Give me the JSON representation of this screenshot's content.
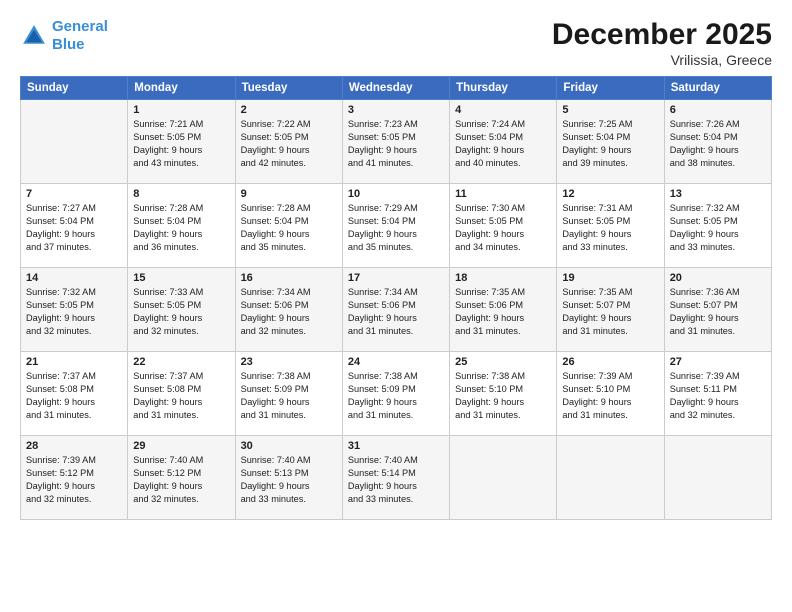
{
  "logo": {
    "line1": "General",
    "line2": "Blue"
  },
  "title": "December 2025",
  "location": "Vrilissia, Greece",
  "days_of_week": [
    "Sunday",
    "Monday",
    "Tuesday",
    "Wednesday",
    "Thursday",
    "Friday",
    "Saturday"
  ],
  "weeks": [
    [
      {
        "day": "",
        "info": ""
      },
      {
        "day": "1",
        "info": "Sunrise: 7:21 AM\nSunset: 5:05 PM\nDaylight: 9 hours\nand 43 minutes."
      },
      {
        "day": "2",
        "info": "Sunrise: 7:22 AM\nSunset: 5:05 PM\nDaylight: 9 hours\nand 42 minutes."
      },
      {
        "day": "3",
        "info": "Sunrise: 7:23 AM\nSunset: 5:05 PM\nDaylight: 9 hours\nand 41 minutes."
      },
      {
        "day": "4",
        "info": "Sunrise: 7:24 AM\nSunset: 5:04 PM\nDaylight: 9 hours\nand 40 minutes."
      },
      {
        "day": "5",
        "info": "Sunrise: 7:25 AM\nSunset: 5:04 PM\nDaylight: 9 hours\nand 39 minutes."
      },
      {
        "day": "6",
        "info": "Sunrise: 7:26 AM\nSunset: 5:04 PM\nDaylight: 9 hours\nand 38 minutes."
      }
    ],
    [
      {
        "day": "7",
        "info": "Sunrise: 7:27 AM\nSunset: 5:04 PM\nDaylight: 9 hours\nand 37 minutes."
      },
      {
        "day": "8",
        "info": "Sunrise: 7:28 AM\nSunset: 5:04 PM\nDaylight: 9 hours\nand 36 minutes."
      },
      {
        "day": "9",
        "info": "Sunrise: 7:28 AM\nSunset: 5:04 PM\nDaylight: 9 hours\nand 35 minutes."
      },
      {
        "day": "10",
        "info": "Sunrise: 7:29 AM\nSunset: 5:04 PM\nDaylight: 9 hours\nand 35 minutes."
      },
      {
        "day": "11",
        "info": "Sunrise: 7:30 AM\nSunset: 5:05 PM\nDaylight: 9 hours\nand 34 minutes."
      },
      {
        "day": "12",
        "info": "Sunrise: 7:31 AM\nSunset: 5:05 PM\nDaylight: 9 hours\nand 33 minutes."
      },
      {
        "day": "13",
        "info": "Sunrise: 7:32 AM\nSunset: 5:05 PM\nDaylight: 9 hours\nand 33 minutes."
      }
    ],
    [
      {
        "day": "14",
        "info": "Sunrise: 7:32 AM\nSunset: 5:05 PM\nDaylight: 9 hours\nand 32 minutes."
      },
      {
        "day": "15",
        "info": "Sunrise: 7:33 AM\nSunset: 5:05 PM\nDaylight: 9 hours\nand 32 minutes."
      },
      {
        "day": "16",
        "info": "Sunrise: 7:34 AM\nSunset: 5:06 PM\nDaylight: 9 hours\nand 32 minutes."
      },
      {
        "day": "17",
        "info": "Sunrise: 7:34 AM\nSunset: 5:06 PM\nDaylight: 9 hours\nand 31 minutes."
      },
      {
        "day": "18",
        "info": "Sunrise: 7:35 AM\nSunset: 5:06 PM\nDaylight: 9 hours\nand 31 minutes."
      },
      {
        "day": "19",
        "info": "Sunrise: 7:35 AM\nSunset: 5:07 PM\nDaylight: 9 hours\nand 31 minutes."
      },
      {
        "day": "20",
        "info": "Sunrise: 7:36 AM\nSunset: 5:07 PM\nDaylight: 9 hours\nand 31 minutes."
      }
    ],
    [
      {
        "day": "21",
        "info": "Sunrise: 7:37 AM\nSunset: 5:08 PM\nDaylight: 9 hours\nand 31 minutes."
      },
      {
        "day": "22",
        "info": "Sunrise: 7:37 AM\nSunset: 5:08 PM\nDaylight: 9 hours\nand 31 minutes."
      },
      {
        "day": "23",
        "info": "Sunrise: 7:38 AM\nSunset: 5:09 PM\nDaylight: 9 hours\nand 31 minutes."
      },
      {
        "day": "24",
        "info": "Sunrise: 7:38 AM\nSunset: 5:09 PM\nDaylight: 9 hours\nand 31 minutes."
      },
      {
        "day": "25",
        "info": "Sunrise: 7:38 AM\nSunset: 5:10 PM\nDaylight: 9 hours\nand 31 minutes."
      },
      {
        "day": "26",
        "info": "Sunrise: 7:39 AM\nSunset: 5:10 PM\nDaylight: 9 hours\nand 31 minutes."
      },
      {
        "day": "27",
        "info": "Sunrise: 7:39 AM\nSunset: 5:11 PM\nDaylight: 9 hours\nand 32 minutes."
      }
    ],
    [
      {
        "day": "28",
        "info": "Sunrise: 7:39 AM\nSunset: 5:12 PM\nDaylight: 9 hours\nand 32 minutes."
      },
      {
        "day": "29",
        "info": "Sunrise: 7:40 AM\nSunset: 5:12 PM\nDaylight: 9 hours\nand 32 minutes."
      },
      {
        "day": "30",
        "info": "Sunrise: 7:40 AM\nSunset: 5:13 PM\nDaylight: 9 hours\nand 33 minutes."
      },
      {
        "day": "31",
        "info": "Sunrise: 7:40 AM\nSunset: 5:14 PM\nDaylight: 9 hours\nand 33 minutes."
      },
      {
        "day": "",
        "info": ""
      },
      {
        "day": "",
        "info": ""
      },
      {
        "day": "",
        "info": ""
      }
    ]
  ]
}
